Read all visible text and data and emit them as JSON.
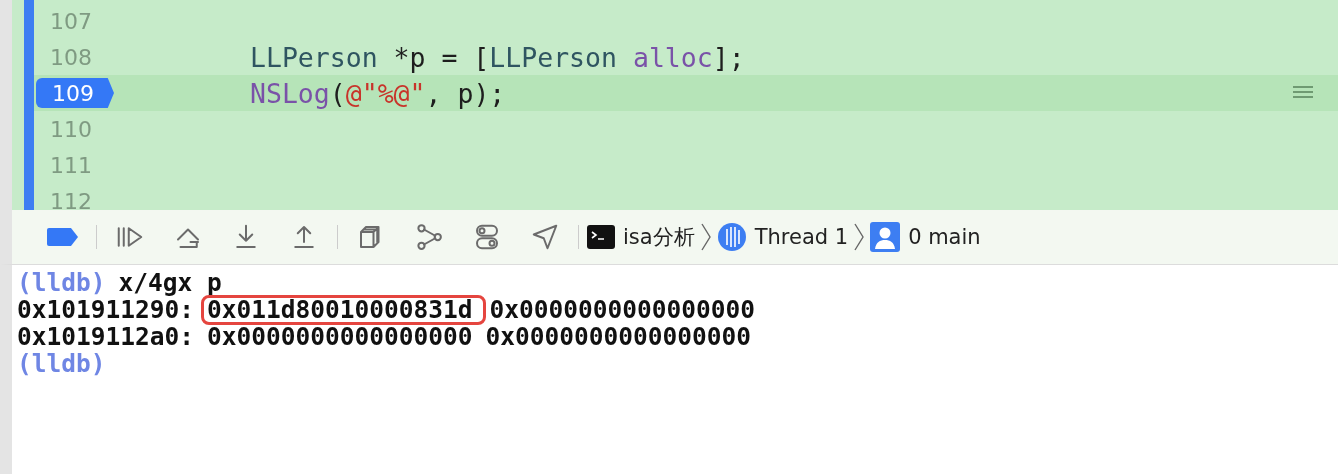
{
  "editor": {
    "lines": [
      {
        "number": "107",
        "current": false
      },
      {
        "number": "108",
        "current": false,
        "tokens": [
          {
            "text": "LLPerson",
            "kind": "type"
          },
          {
            "text": " *p = [",
            "kind": "plain"
          },
          {
            "text": "LLPerson",
            "kind": "type"
          },
          {
            "text": " alloc",
            "kind": "method"
          },
          {
            "text": "];",
            "kind": "plain"
          }
        ]
      },
      {
        "number": "109",
        "current": true,
        "tokens": [
          {
            "text": "NSLog",
            "kind": "method"
          },
          {
            "text": "(",
            "kind": "plain"
          },
          {
            "text": "@\"%@\"",
            "kind": "string"
          },
          {
            "text": ", p);",
            "kind": "plain"
          }
        ]
      },
      {
        "number": "110",
        "current": false
      },
      {
        "number": "111",
        "current": false
      },
      {
        "number": "112",
        "current": false
      }
    ]
  },
  "toolbar": {
    "buttons": [
      {
        "kind": "breakpoints",
        "active": true
      },
      {
        "kind": "continue",
        "active": false
      },
      {
        "kind": "step-over",
        "active": false
      },
      {
        "kind": "step-into",
        "active": false
      },
      {
        "kind": "step-out",
        "active": false
      },
      {
        "kind": "view-hierarchy",
        "active": false
      },
      {
        "kind": "memory-graph",
        "active": false
      },
      {
        "kind": "environment",
        "active": false
      },
      {
        "kind": "location",
        "active": false
      }
    ],
    "breadcrumbs": [
      {
        "kind": "target",
        "label": "isa分析"
      },
      {
        "kind": "thread",
        "label": "Thread 1"
      },
      {
        "kind": "frame",
        "label": "0 main"
      }
    ]
  },
  "console": {
    "lines": [
      {
        "segments": [
          {
            "text": "(lldb)",
            "kind": "prompt",
            "highlighted": false
          },
          {
            "text": "x/4gx p",
            "kind": "output",
            "highlighted": false
          }
        ]
      },
      {
        "segments": [
          {
            "text": "0x101911290:",
            "kind": "output",
            "highlighted": false
          },
          {
            "text": "0x011d80010000831d",
            "kind": "output",
            "highlighted": true
          },
          {
            "text": "0x0000000000000000",
            "kind": "output",
            "highlighted": false
          }
        ]
      },
      {
        "segments": [
          {
            "text": "0x1019112a0:",
            "kind": "output",
            "highlighted": false
          },
          {
            "text": "0x0000000000000000",
            "kind": "output",
            "highlighted": false
          },
          {
            "text": "0x0000000000000000",
            "kind": "output",
            "highlighted": false
          }
        ]
      },
      {
        "segments": [
          {
            "text": "(lldb)",
            "kind": "prompt",
            "highlighted": false
          }
        ]
      }
    ]
  }
}
